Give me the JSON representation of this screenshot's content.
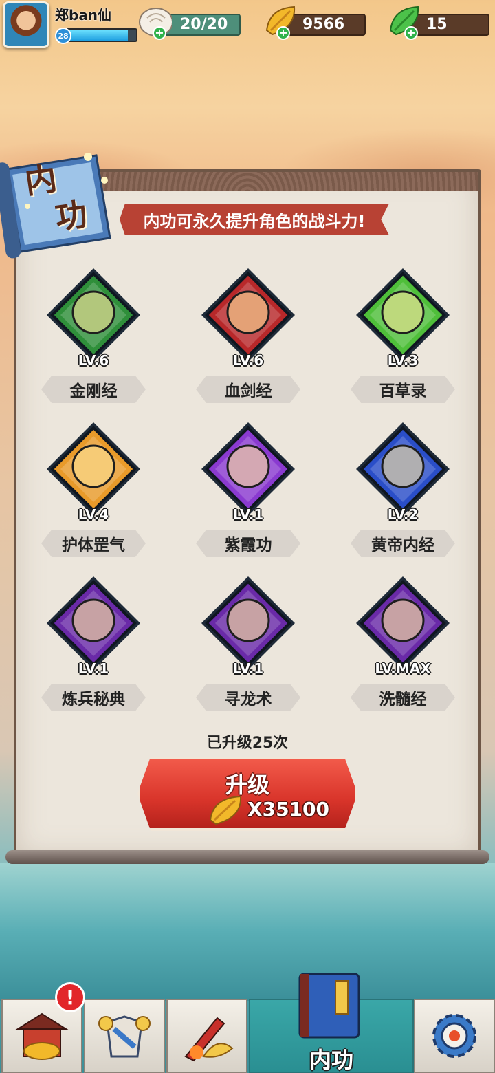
{
  "player": {
    "name": "郑ban仙",
    "level": "28",
    "xp_fraction": 0.88
  },
  "resources": {
    "stamina": "20/20",
    "gold": "9566",
    "leaf": "15"
  },
  "page": {
    "title_main": "内",
    "title_sub": "功",
    "banner": "内功可永久提升角色的战斗力!"
  },
  "skills": [
    {
      "name": "金刚经",
      "level": "LV.6",
      "icon": "green-muscle-figure-icon",
      "color": "#2f8f3a"
    },
    {
      "name": "血剑经",
      "level": "LV.6",
      "icon": "red-sword-icon",
      "color": "#b8282a"
    },
    {
      "name": "百草录",
      "level": "LV.3",
      "icon": "green-leaf-icon",
      "color": "#4fbf3a"
    },
    {
      "name": "护体罡气",
      "level": "LV.4",
      "icon": "golden-aura-figure-icon",
      "color": "#e89a2a"
    },
    {
      "name": "紫霞功",
      "level": "LV.1",
      "icon": "purple-palm-icon",
      "color": "#8a3ad0"
    },
    {
      "name": "黄帝内经",
      "level": "LV.2",
      "icon": "blue-figure-plus-icon",
      "color": "#2a4ec8"
    },
    {
      "name": "炼兵秘典",
      "level": "LV.1",
      "icon": "anvil-icon",
      "color": "#6a2aa8"
    },
    {
      "name": "寻龙术",
      "level": "LV.1",
      "icon": "gold-ingot-icon",
      "color": "#6a2aa8"
    },
    {
      "name": "洗髓经",
      "level": "LV.MAX",
      "icon": "red-figure-icon",
      "color": "#6a2aa8"
    }
  ],
  "upgrade": {
    "count_text": "已升级25次",
    "button_label": "升级",
    "cost": "X35100"
  },
  "nav": {
    "tabs": [
      "shop-tab",
      "armor-tab",
      "weapon-tab",
      "skill-book-tab",
      "settings-tab"
    ],
    "active_label": "内功",
    "badge": "!"
  },
  "colors": {
    "banner": "#b84234",
    "button": "#d8342a",
    "active_tab": "#3aa7a8"
  }
}
